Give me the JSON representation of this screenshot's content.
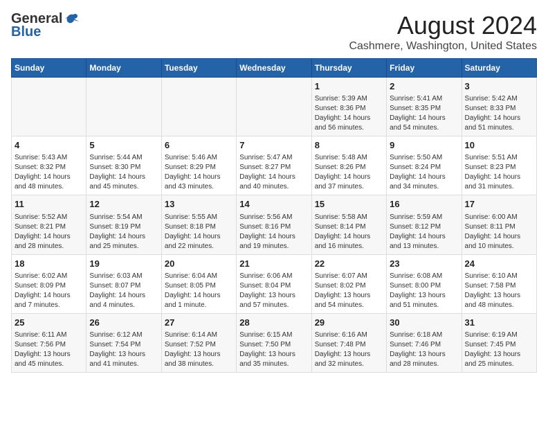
{
  "header": {
    "logo_general": "General",
    "logo_blue": "Blue",
    "main_title": "August 2024",
    "subtitle": "Cashmere, Washington, United States"
  },
  "calendar": {
    "days_of_week": [
      "Sunday",
      "Monday",
      "Tuesday",
      "Wednesday",
      "Thursday",
      "Friday",
      "Saturday"
    ],
    "weeks": [
      [
        {
          "day": "",
          "info": ""
        },
        {
          "day": "",
          "info": ""
        },
        {
          "day": "",
          "info": ""
        },
        {
          "day": "",
          "info": ""
        },
        {
          "day": "1",
          "info": "Sunrise: 5:39 AM\nSunset: 8:36 PM\nDaylight: 14 hours\nand 56 minutes."
        },
        {
          "day": "2",
          "info": "Sunrise: 5:41 AM\nSunset: 8:35 PM\nDaylight: 14 hours\nand 54 minutes."
        },
        {
          "day": "3",
          "info": "Sunrise: 5:42 AM\nSunset: 8:33 PM\nDaylight: 14 hours\nand 51 minutes."
        }
      ],
      [
        {
          "day": "4",
          "info": "Sunrise: 5:43 AM\nSunset: 8:32 PM\nDaylight: 14 hours\nand 48 minutes."
        },
        {
          "day": "5",
          "info": "Sunrise: 5:44 AM\nSunset: 8:30 PM\nDaylight: 14 hours\nand 45 minutes."
        },
        {
          "day": "6",
          "info": "Sunrise: 5:46 AM\nSunset: 8:29 PM\nDaylight: 14 hours\nand 43 minutes."
        },
        {
          "day": "7",
          "info": "Sunrise: 5:47 AM\nSunset: 8:27 PM\nDaylight: 14 hours\nand 40 minutes."
        },
        {
          "day": "8",
          "info": "Sunrise: 5:48 AM\nSunset: 8:26 PM\nDaylight: 14 hours\nand 37 minutes."
        },
        {
          "day": "9",
          "info": "Sunrise: 5:50 AM\nSunset: 8:24 PM\nDaylight: 14 hours\nand 34 minutes."
        },
        {
          "day": "10",
          "info": "Sunrise: 5:51 AM\nSunset: 8:23 PM\nDaylight: 14 hours\nand 31 minutes."
        }
      ],
      [
        {
          "day": "11",
          "info": "Sunrise: 5:52 AM\nSunset: 8:21 PM\nDaylight: 14 hours\nand 28 minutes."
        },
        {
          "day": "12",
          "info": "Sunrise: 5:54 AM\nSunset: 8:19 PM\nDaylight: 14 hours\nand 25 minutes."
        },
        {
          "day": "13",
          "info": "Sunrise: 5:55 AM\nSunset: 8:18 PM\nDaylight: 14 hours\nand 22 minutes."
        },
        {
          "day": "14",
          "info": "Sunrise: 5:56 AM\nSunset: 8:16 PM\nDaylight: 14 hours\nand 19 minutes."
        },
        {
          "day": "15",
          "info": "Sunrise: 5:58 AM\nSunset: 8:14 PM\nDaylight: 14 hours\nand 16 minutes."
        },
        {
          "day": "16",
          "info": "Sunrise: 5:59 AM\nSunset: 8:12 PM\nDaylight: 14 hours\nand 13 minutes."
        },
        {
          "day": "17",
          "info": "Sunrise: 6:00 AM\nSunset: 8:11 PM\nDaylight: 14 hours\nand 10 minutes."
        }
      ],
      [
        {
          "day": "18",
          "info": "Sunrise: 6:02 AM\nSunset: 8:09 PM\nDaylight: 14 hours\nand 7 minutes."
        },
        {
          "day": "19",
          "info": "Sunrise: 6:03 AM\nSunset: 8:07 PM\nDaylight: 14 hours\nand 4 minutes."
        },
        {
          "day": "20",
          "info": "Sunrise: 6:04 AM\nSunset: 8:05 PM\nDaylight: 14 hours\nand 1 minute."
        },
        {
          "day": "21",
          "info": "Sunrise: 6:06 AM\nSunset: 8:04 PM\nDaylight: 13 hours\nand 57 minutes."
        },
        {
          "day": "22",
          "info": "Sunrise: 6:07 AM\nSunset: 8:02 PM\nDaylight: 13 hours\nand 54 minutes."
        },
        {
          "day": "23",
          "info": "Sunrise: 6:08 AM\nSunset: 8:00 PM\nDaylight: 13 hours\nand 51 minutes."
        },
        {
          "day": "24",
          "info": "Sunrise: 6:10 AM\nSunset: 7:58 PM\nDaylight: 13 hours\nand 48 minutes."
        }
      ],
      [
        {
          "day": "25",
          "info": "Sunrise: 6:11 AM\nSunset: 7:56 PM\nDaylight: 13 hours\nand 45 minutes."
        },
        {
          "day": "26",
          "info": "Sunrise: 6:12 AM\nSunset: 7:54 PM\nDaylight: 13 hours\nand 41 minutes."
        },
        {
          "day": "27",
          "info": "Sunrise: 6:14 AM\nSunset: 7:52 PM\nDaylight: 13 hours\nand 38 minutes."
        },
        {
          "day": "28",
          "info": "Sunrise: 6:15 AM\nSunset: 7:50 PM\nDaylight: 13 hours\nand 35 minutes."
        },
        {
          "day": "29",
          "info": "Sunrise: 6:16 AM\nSunset: 7:48 PM\nDaylight: 13 hours\nand 32 minutes."
        },
        {
          "day": "30",
          "info": "Sunrise: 6:18 AM\nSunset: 7:46 PM\nDaylight: 13 hours\nand 28 minutes."
        },
        {
          "day": "31",
          "info": "Sunrise: 6:19 AM\nSunset: 7:45 PM\nDaylight: 13 hours\nand 25 minutes."
        }
      ]
    ]
  }
}
